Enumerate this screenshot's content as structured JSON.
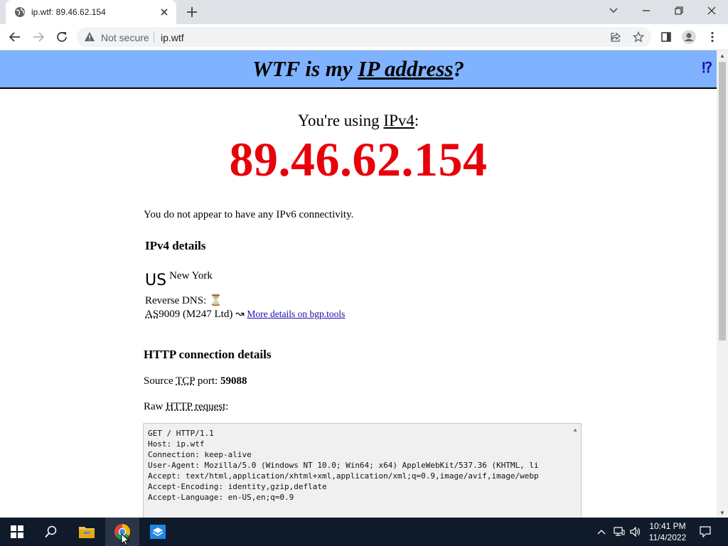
{
  "browser": {
    "tab_title": "ip.wtf: 89.46.62.154",
    "security_label": "Not secure",
    "url": "ip.wtf"
  },
  "page": {
    "banner": {
      "prefix": "WTF is my ",
      "link": "IP address",
      "suffix": "?",
      "corner": "⁉"
    },
    "using": {
      "prefix": "You're using ",
      "protocol": "IPv4",
      "suffix": ":"
    },
    "ip": "89.46.62.154",
    "ipv6_note": "You do not appear to have any IPv6 connectivity.",
    "ipv4_heading": "IPv4 details",
    "country": "US",
    "city": "New York",
    "rdns_label": "Reverse DNS:",
    "rdns_value": "⏳",
    "as_abbr": "AS",
    "as_text": "9009 (M247 Ltd) ↝ ",
    "as_link": "More details on bgp.tools",
    "http_heading": "HTTP connection details",
    "port_prefix": "Source ",
    "port_abbr": "TCP",
    "port_mid": " port: ",
    "port_value": "59088",
    "raw_prefix": "Raw ",
    "raw_abbr": "HTTP request",
    "raw_suffix": ":",
    "raw_lines": [
      "GET / HTTP/1.1",
      "Host: ip.wtf",
      "Connection: keep-alive",
      "User-Agent: Mozilla/5.0 (Windows NT 10.0; Win64; x64) AppleWebKit/537.36 (KHTML, li",
      "Accept: text/html,application/xhtml+xml,application/xml;q=0.9,image/avif,image/webp",
      "Accept-Encoding: identity,gzip,deflate",
      "Accept-Language: en-US,en;q=0.9"
    ]
  },
  "taskbar": {
    "time": "10:41 PM",
    "date": "11/4/2022"
  },
  "colors": {
    "banner": "#80b3ff",
    "ip": "#e8000b",
    "taskbar": "#0f1a2a"
  }
}
